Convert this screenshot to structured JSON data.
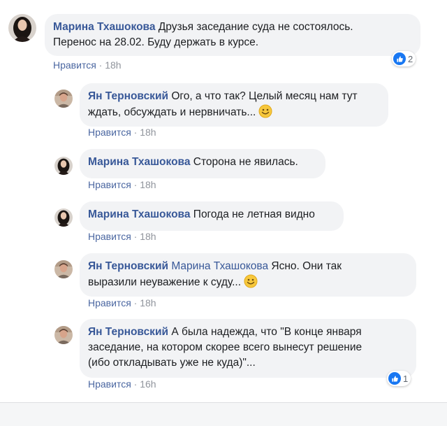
{
  "comments": [
    {
      "author": "Марина Тхашокова",
      "text": "Друзья заседание суда не состоялось.",
      "text2": "Перенос на 28.02. Буду держать в курсе.",
      "like_label": "Нравится",
      "dot": "·",
      "time": "18h",
      "reactions_count": "2"
    },
    {
      "author": "Ян Терновский",
      "text": "Ого, а что так? Целый месяц нам тут",
      "text2": "ждать, обсуждать и нервничать...",
      "like_label": "Нравится",
      "dot": "·",
      "time": "18h"
    },
    {
      "author": "Марина Тхашокова",
      "text": "Сторона не явилась.",
      "like_label": "Нравится",
      "dot": "·",
      "time": "18h"
    },
    {
      "author": "Марина Тхашокова",
      "text": "Погода не летная видно",
      "like_label": "Нравится",
      "dot": "·",
      "time": "18h"
    },
    {
      "author": "Ян Терновский",
      "mention": "Марина Тхашокова",
      "text": "Ясно. Они так",
      "text2": "выразили неуважение к суду...",
      "like_label": "Нравится",
      "dot": "·",
      "time": "18h"
    },
    {
      "author": "Ян Терновский",
      "text": "А была надежда, что \"В конце января",
      "text2": "заседание, на котором скорее всего вынесут решение",
      "text3": "(ибо откладывать уже не куда)\"...",
      "like_label": "Нравится",
      "dot": "·",
      "time": "16h",
      "reactions_count": "1"
    }
  ],
  "colors": {
    "name": "#385898",
    "bubble": "#f2f3f5",
    "like_badge": "#1877f2",
    "meta_gray": "#90949c"
  },
  "icons": {
    "reaction": "thumbs-up-icon",
    "emoji": "smiling-face-icon"
  }
}
